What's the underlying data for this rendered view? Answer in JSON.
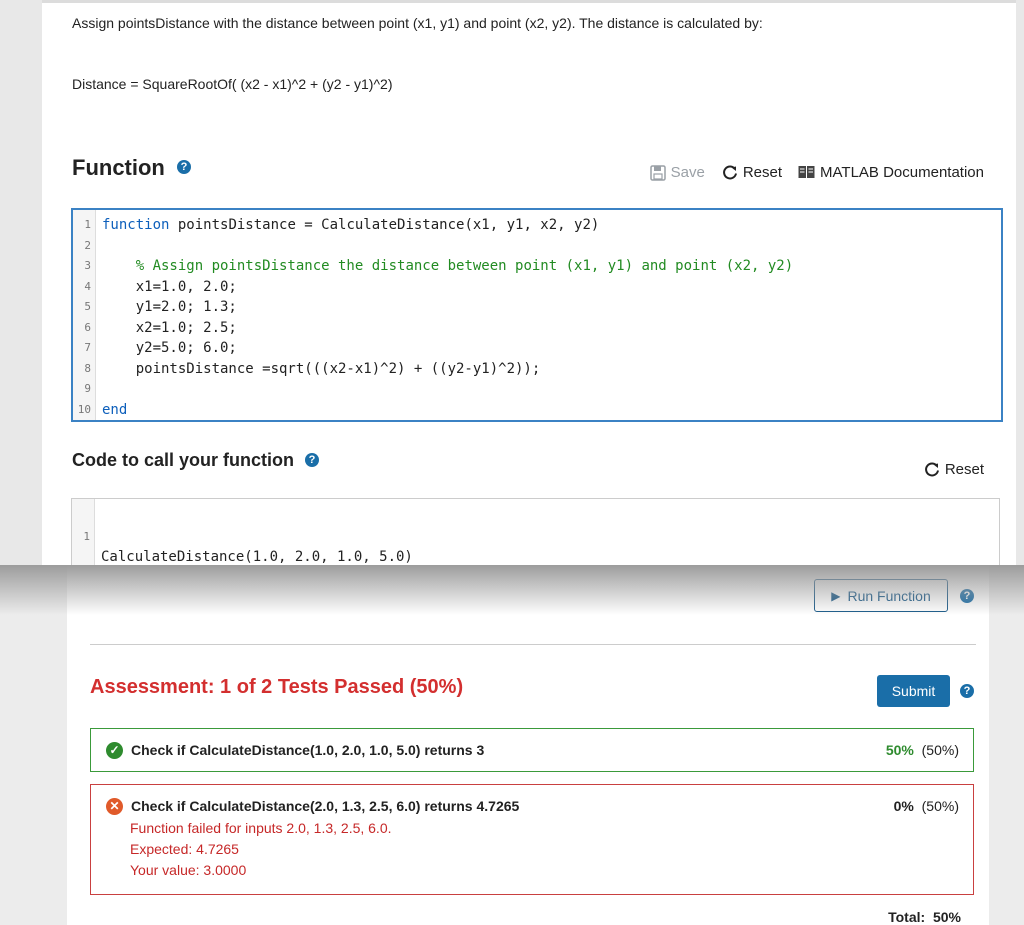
{
  "problem": {
    "intro": "Assign pointsDistance with the distance between point (x1, y1) and point (x2, y2). The distance is calculated by:",
    "formula": "Distance =  SquareRootOf( (x2 - x1)^2 + (y2 - y1)^2)"
  },
  "function_section": {
    "title": "Function",
    "help_icon": "?",
    "toolbar": {
      "save_label": "Save",
      "reset_label": "Reset",
      "doc_label": "MATLAB Documentation"
    }
  },
  "editor": {
    "lines": [
      {
        "num": "1",
        "kw": "function",
        "text": " pointsDistance = CalculateDistance(x1, y1, x2, y2)",
        "comment": ""
      },
      {
        "num": "2",
        "kw": "",
        "text": "",
        "comment": ""
      },
      {
        "num": "3",
        "kw": "",
        "text": "    ",
        "comment": "% Assign pointsDistance the distance between point (x1, y1) and point (x2, y2)"
      },
      {
        "num": "4",
        "kw": "",
        "text": "    x1=1.0, 2.0;",
        "comment": ""
      },
      {
        "num": "5",
        "kw": "",
        "text": "    y1=2.0; 1.3;",
        "comment": ""
      },
      {
        "num": "6",
        "kw": "",
        "text": "    x2=1.0; 2.5;",
        "comment": ""
      },
      {
        "num": "7",
        "kw": "",
        "text": "    y2=5.0; 6.0;",
        "comment": ""
      },
      {
        "num": "8",
        "kw": "",
        "text": "    pointsDistance =sqrt(((x2-x1)^2) + ((y2-y1)^2));",
        "comment": ""
      },
      {
        "num": "9",
        "kw": "",
        "text": "",
        "comment": ""
      },
      {
        "num": "10",
        "kw": "end",
        "text": "",
        "comment": ""
      }
    ]
  },
  "call_section": {
    "title": "Code to call your function",
    "reset_label": "Reset",
    "line_num": "1",
    "code": "CalculateDistance(1.0, 2.0, 1.0, 5.0)"
  },
  "run": {
    "label": "Run Function"
  },
  "assessment": {
    "title": "Assessment: 1 of 2 Tests Passed (50%)",
    "submit_label": "Submit",
    "tests": [
      {
        "status": "pass",
        "label": "Check if CalculateDistance(1.0, 2.0, 1.0, 5.0) returns 3",
        "score": "50%",
        "weight": "(50%)"
      },
      {
        "status": "fail",
        "label": "Check if CalculateDistance(2.0, 1.3, 2.5, 6.0) returns 4.7265",
        "score": "0%",
        "weight": "(50%)",
        "details": [
          "Function failed for inputs 2.0, 1.3, 2.5, 6.0.",
          "Expected: 4.7265",
          "Your value: 3.0000"
        ]
      }
    ],
    "total_label": "Total:",
    "total_value": "50%"
  },
  "colors": {
    "accent": "#1a6ea8",
    "fail": "#d32f2f",
    "pass": "#2e8b2e"
  }
}
